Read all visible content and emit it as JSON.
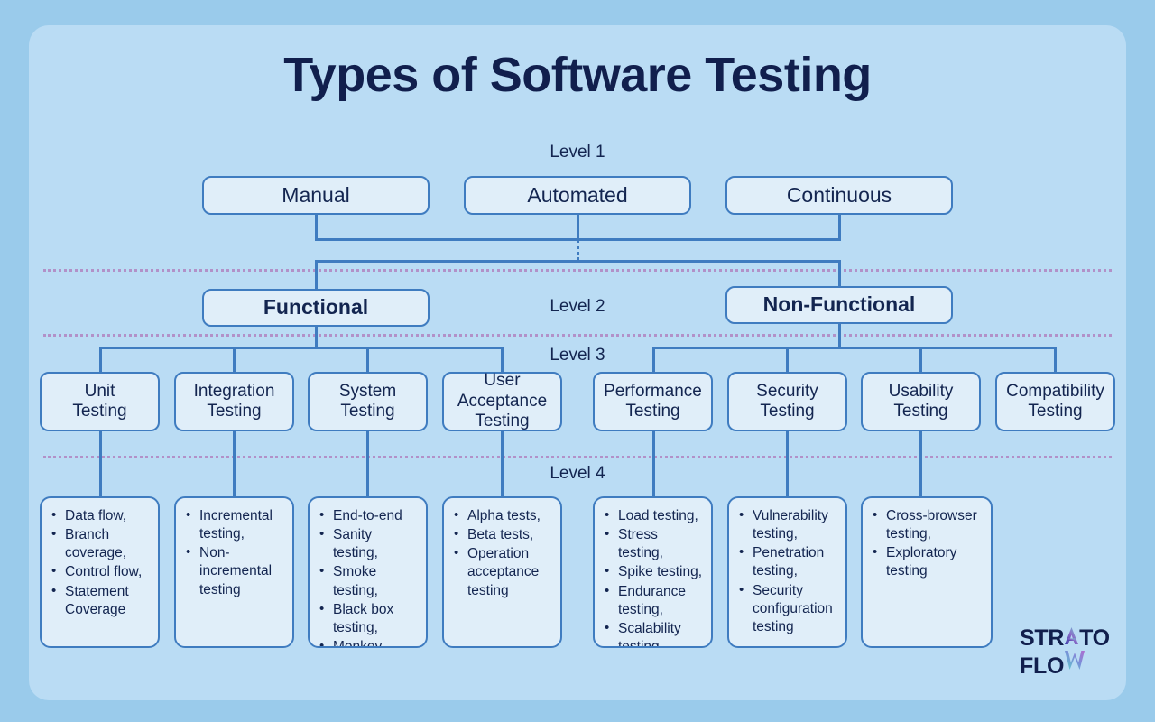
{
  "title": "Types of Software Testing",
  "colors": {
    "page_background": "#9ACBEB",
    "panel_background": "#BADCF4",
    "box_fill": "#E0EEF9",
    "box_border": "#3F7CC0",
    "text": "#132550",
    "title": "#111F4D",
    "separator": "#B291C8"
  },
  "level_labels": {
    "level1": "Level 1",
    "level2": "Level 2",
    "level3": "Level 3",
    "level4": "Level 4"
  },
  "level1": [
    {
      "label": "Manual"
    },
    {
      "label": "Automated"
    },
    {
      "label": "Continuous"
    }
  ],
  "level2": [
    {
      "label": "Functional"
    },
    {
      "label": "Non-Functional"
    }
  ],
  "level3": [
    {
      "label": "Unit\nTesting"
    },
    {
      "label": "Integration\nTesting"
    },
    {
      "label": "System\nTesting"
    },
    {
      "label": "User\nAcceptance\nTesting"
    },
    {
      "label": "Performance\nTesting"
    },
    {
      "label": "Security\nTesting"
    },
    {
      "label": "Usability\nTesting"
    },
    {
      "label": "Compatibility\nTesting"
    }
  ],
  "level4": [
    {
      "parent": "Unit Testing",
      "items": [
        "Data flow,",
        "Branch coverage,",
        "Control flow,",
        "Statement Coverage"
      ]
    },
    {
      "parent": "Integration Testing",
      "items": [
        "Incremental testing,",
        "Non-incremental testing"
      ]
    },
    {
      "parent": "System Testing",
      "items": [
        "End-to-end",
        "Sanity testing,",
        "Smoke testing,",
        "Black box testing,",
        "Monkey testing"
      ]
    },
    {
      "parent": "User Acceptance Testing",
      "items": [
        "Alpha tests,",
        "Beta tests,",
        "Operation acceptance testing"
      ]
    },
    {
      "parent": "Performance Testing",
      "items": [
        "Load testing,",
        "Stress testing,",
        "Spike testing,",
        "Endurance testing,",
        "Scalability testing"
      ]
    },
    {
      "parent": "Security Testing",
      "items": [
        "Vulnerability testing,",
        "Penetration testing,",
        "Security configuration testing"
      ]
    },
    {
      "parent": "Usability Testing",
      "items": [
        "Cross-browser testing,",
        "Exploratory testing"
      ]
    }
  ],
  "logo": {
    "line1_prefix": "STR",
    "line1_a": "A",
    "line1_suffix": "TO",
    "line2_prefix": "FLO",
    "line2_w": "W"
  }
}
